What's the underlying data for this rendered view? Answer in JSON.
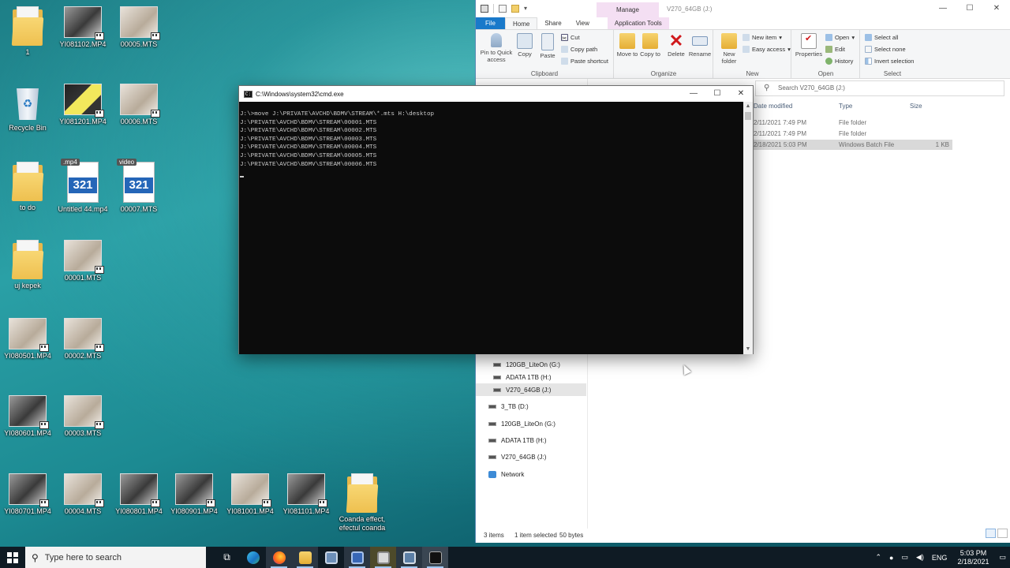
{
  "desktop": {
    "icons": [
      {
        "label": "1",
        "kind": "folder"
      },
      {
        "label": "YI081102.MP4",
        "kind": "video"
      },
      {
        "label": "00005.MTS",
        "kind": "video"
      },
      {
        "label": "Recycle Bin",
        "kind": "recycle"
      },
      {
        "label": "YI081201.MP4",
        "kind": "video"
      },
      {
        "label": "00006.MTS",
        "kind": "video"
      },
      {
        "label": "to do",
        "kind": "folder"
      },
      {
        "label": "Untitled 44.mp4",
        "kind": "mpc",
        "tag": ".mp4"
      },
      {
        "label": "00007.MTS",
        "kind": "mpc",
        "tag": "video"
      },
      {
        "label": "uj kepek",
        "kind": "folder"
      },
      {
        "label": "00001.MTS",
        "kind": "video"
      },
      {
        "label": "YI080501.MP4",
        "kind": "video"
      },
      {
        "label": "00002.MTS",
        "kind": "video"
      },
      {
        "label": "YI080601.MP4",
        "kind": "video"
      },
      {
        "label": "00003.MTS",
        "kind": "video"
      },
      {
        "label": "YI080701.MP4",
        "kind": "video"
      },
      {
        "label": "00004.MTS",
        "kind": "video"
      },
      {
        "label": "YI080801.MP4",
        "kind": "video"
      },
      {
        "label": "YI080901.MP4",
        "kind": "video"
      },
      {
        "label": "YI081001.MP4",
        "kind": "video"
      },
      {
        "label": "YI081101.MP4",
        "kind": "video"
      },
      {
        "label": "Coanda effect, efectul coanda",
        "kind": "folder"
      }
    ]
  },
  "explorer": {
    "window_title": "V270_64GB (J:)",
    "manage_tab": "Manage",
    "tabs": {
      "file": "File",
      "home": "Home",
      "share": "Share",
      "view": "View",
      "app_tools": "Application Tools"
    },
    "ribbon": {
      "pin": "Pin to Quick access",
      "copy": "Copy",
      "paste": "Paste",
      "cut": "Cut",
      "copy_path": "Copy path",
      "paste_shortcut": "Paste shortcut",
      "clipboard": "Clipboard",
      "move_to": "Move to",
      "copy_to": "Copy to",
      "delete": "Delete",
      "rename": "Rename",
      "organize": "Organize",
      "new_folder": "New folder",
      "new_item": "New item",
      "easy_access": "Easy access",
      "new": "New",
      "properties": "Properties",
      "open_btn": "Open",
      "edit": "Edit",
      "history": "History",
      "open_group": "Open",
      "select_all": "Select all",
      "select_none": "Select none",
      "invert_selection": "Invert selection",
      "select_group": "Select"
    },
    "search_placeholder": "Search V270_64GB (J:)",
    "columns": {
      "date": "Date modified",
      "type": "Type",
      "size": "Size"
    },
    "files": [
      {
        "date": "2/11/2021 7:49 PM",
        "type": "File folder",
        "size": ""
      },
      {
        "date": "2/11/2021 7:49 PM",
        "type": "File folder",
        "size": ""
      },
      {
        "date": "2/18/2021 5:03 PM",
        "type": "Windows Batch File",
        "size": "1 KB"
      }
    ],
    "nav": [
      {
        "label": "120GB_LiteOn (G:)",
        "kind": "drive"
      },
      {
        "label": "ADATA 1TB (H:)",
        "kind": "drive"
      },
      {
        "label": "V270_64GB (J:)",
        "kind": "drive"
      },
      {
        "label": "3_TB (D:)",
        "kind": "drive"
      },
      {
        "label": "120GB_LiteOn (G:)",
        "kind": "drive"
      },
      {
        "label": "ADATA 1TB (H:)",
        "kind": "drive"
      },
      {
        "label": "V270_64GB (J:)",
        "kind": "drive"
      },
      {
        "label": "Network",
        "kind": "network"
      }
    ],
    "status": {
      "items": "3 items",
      "selected": "1 item selected",
      "bytes": "50 bytes"
    }
  },
  "cmd": {
    "title": "C:\\Windows\\system32\\cmd.exe",
    "lines": [
      "J:\\>move J:\\PRIVATE\\AVCHD\\BDMV\\STREAM\\*.mts H:\\desktop",
      "J:\\PRIVATE\\AVCHD\\BDMV\\STREAM\\00001.MTS",
      "J:\\PRIVATE\\AVCHD\\BDMV\\STREAM\\00002.MTS",
      "J:\\PRIVATE\\AVCHD\\BDMV\\STREAM\\00003.MTS",
      "J:\\PRIVATE\\AVCHD\\BDMV\\STREAM\\00004.MTS",
      "J:\\PRIVATE\\AVCHD\\BDMV\\STREAM\\00005.MTS",
      "J:\\PRIVATE\\AVCHD\\BDMV\\STREAM\\00006.MTS"
    ]
  },
  "taskbar": {
    "search_placeholder": "Type here to search",
    "lang": "ENG",
    "time": "5:03 PM",
    "date": "2/18/2021"
  }
}
